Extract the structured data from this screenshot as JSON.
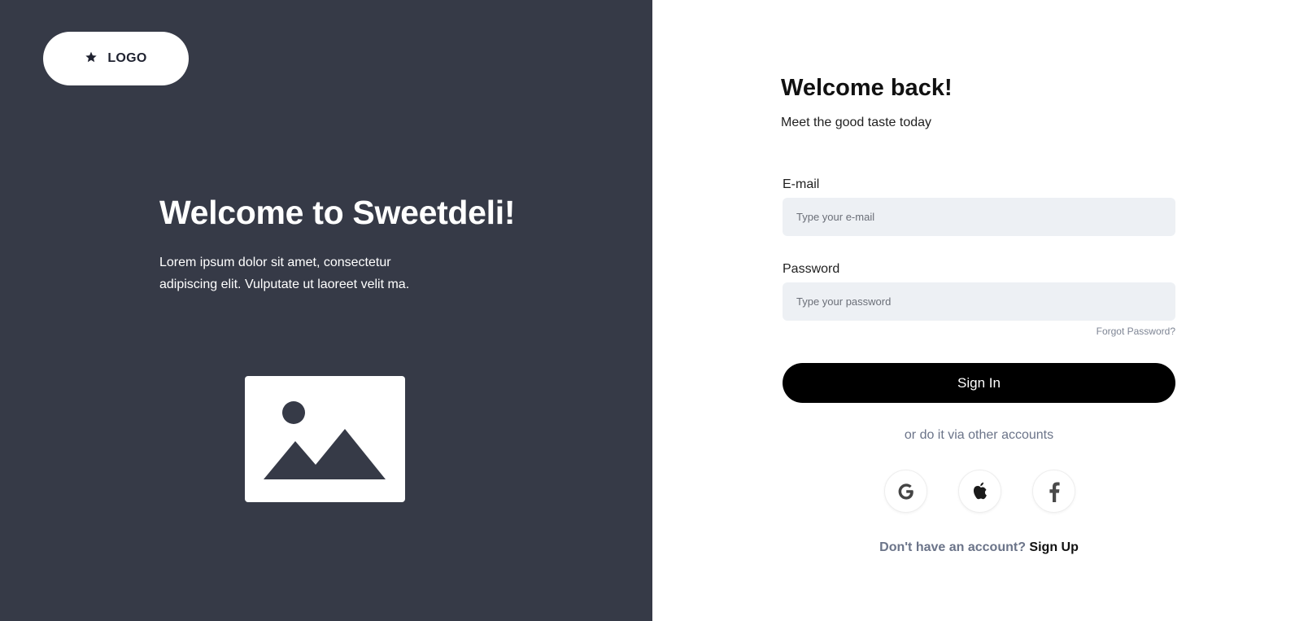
{
  "brand": {
    "logo_text": "LOGO",
    "logo_icon": "star-icon"
  },
  "hero": {
    "title": "Welcome to Sweetdeli!",
    "text": "Lorem ipsum dolor sit amet, consectetur adipiscing elit. Vulputate ut laoreet velit ma.",
    "image_icon": "image-placeholder-icon"
  },
  "form": {
    "title": "Welcome back!",
    "subtitle": "Meet the good taste today",
    "email": {
      "label": "E-mail",
      "placeholder": "Type your e-mail",
      "value": ""
    },
    "password": {
      "label": "Password",
      "placeholder": "Type your password",
      "value": ""
    },
    "forgot_label": "Forgot Password?",
    "signin_label": "Sign In",
    "alt_text": "or do it via other accounts",
    "social": [
      {
        "icon": "google-icon"
      },
      {
        "icon": "apple-icon"
      },
      {
        "icon": "facebook-icon"
      }
    ],
    "signup_question": "Don't have an account?",
    "signup_label": "Sign Up"
  },
  "colors": {
    "left_panel_bg": "#363a47",
    "input_bg": "#edf0f4",
    "primary_button_bg": "#000000",
    "muted_text": "#6b7489"
  }
}
